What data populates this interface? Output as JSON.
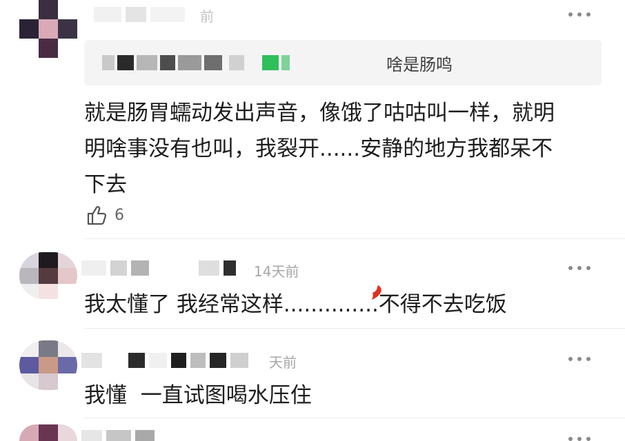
{
  "comments": [
    {
      "timestamp": "前",
      "reply_quote": "啥是肠鸣",
      "text": "就是肠胃蠕动发出声音，像饿了咕咕叫一样，就明\n明啥事没有也叫，我裂开......安静的地方我都呆不\n下去",
      "likes": "6"
    },
    {
      "timestamp": "14天前",
      "text": "我太懂了 我经常这样..............不得不去吃饭"
    },
    {
      "timestamp": "天前",
      "text": "我懂  一直试图喝水压住"
    }
  ],
  "icons": {
    "more": "more-dots-icon",
    "like": "thumbs-up-icon"
  },
  "colors": {
    "timestamp": "#a6a6a6",
    "quote_bg": "#f4f4f4",
    "text": "#1e1e1e"
  }
}
